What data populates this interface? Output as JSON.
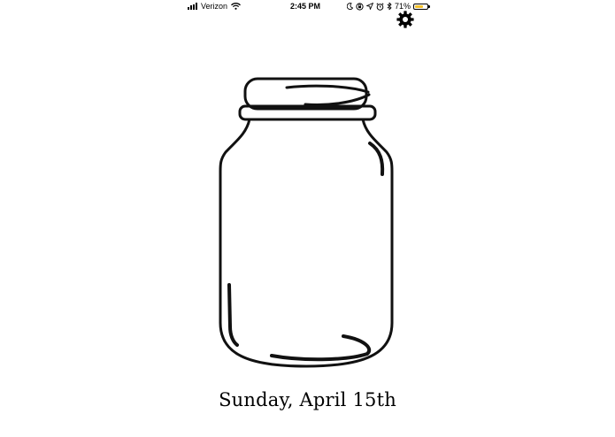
{
  "status_bar": {
    "carrier": "Verizon",
    "time": "2:45 PM",
    "battery_percent": "71%",
    "battery_level": 0.71,
    "battery_color": "#f4c02b",
    "icons": [
      "cellular-signal-icon",
      "wifi-icon",
      "moon-icon",
      "rotation-lock-icon",
      "location-arrow-icon",
      "alarm-icon",
      "bluetooth-icon",
      "battery-icon"
    ]
  },
  "settings": {
    "icon": "gear-icon"
  },
  "main": {
    "jar_icon": "mason-jar-icon",
    "date": "Sunday, April 15th"
  }
}
